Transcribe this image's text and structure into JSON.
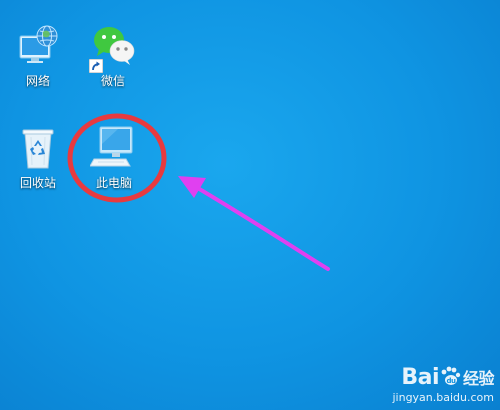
{
  "desktop": {
    "background": "#0f94e2",
    "icons": [
      {
        "label": "网络",
        "icon": "network-globe-icon"
      },
      {
        "label": "微信",
        "icon": "wechat-icon",
        "shortcut": true
      },
      {
        "label": "回收站",
        "icon": "recycle-bin-icon"
      },
      {
        "label": "此电脑",
        "icon": "this-pc-monitor-icon"
      }
    ]
  },
  "annotation": {
    "circle_color": "#e83a3f",
    "arrow_color": "#e040f0"
  },
  "watermark": {
    "brand": "Bai",
    "brand_suffix": "经验",
    "url": "jingyan.baidu.com"
  }
}
